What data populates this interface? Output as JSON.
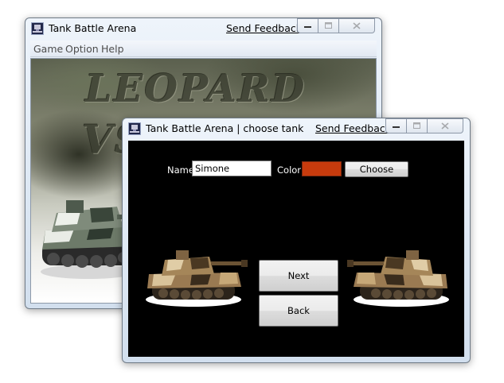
{
  "back_window": {
    "title": "Tank Battle Arena",
    "feedback_link": "Send Feedback",
    "menu": [
      "Game",
      "Option",
      "Help"
    ],
    "banner": {
      "line1": "LEOPARD",
      "line2": "VS"
    }
  },
  "front_window": {
    "title": "Tank Battle Arena | choose tank",
    "feedback_link": "Send Feedback",
    "name_label": "Name",
    "name_value": "Simone",
    "color_label": "Color",
    "selected_color": "#c73b0d",
    "choose_label": "Choose",
    "next_label": "Next",
    "back_label": "Back"
  },
  "icons": [
    "app-icon",
    "minimize-icon",
    "maximize-icon",
    "close-icon",
    "tank-image-left",
    "tank-image-right",
    "tank-illustration-leopard"
  ]
}
